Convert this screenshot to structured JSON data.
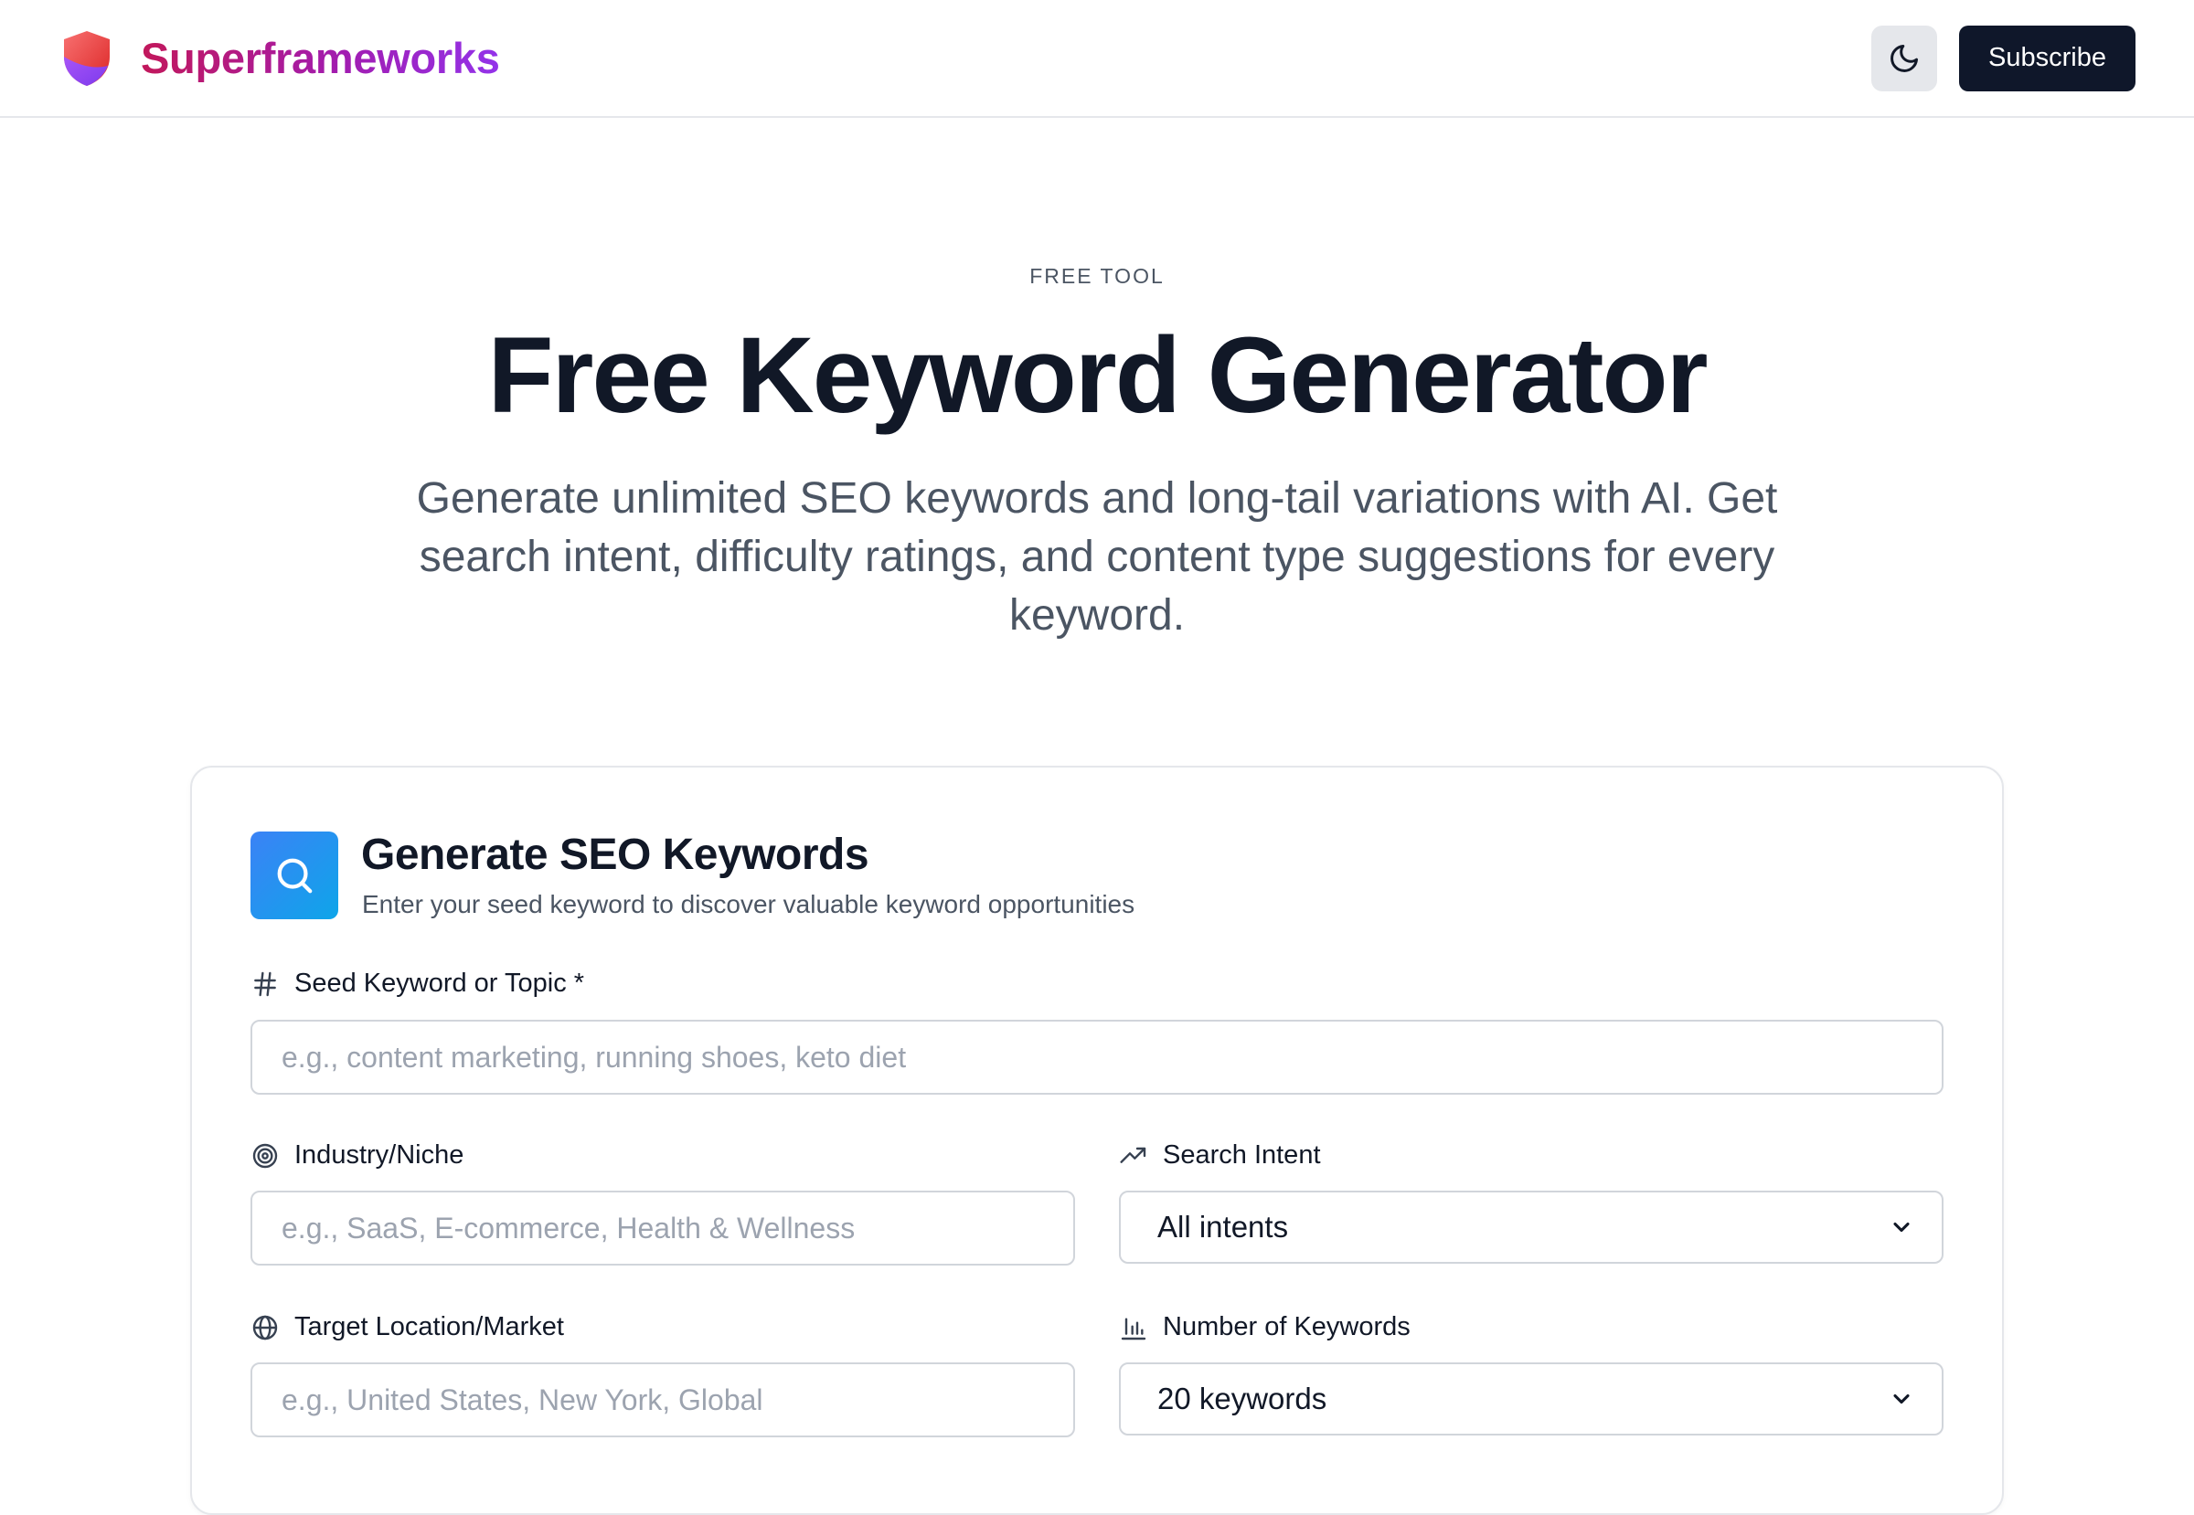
{
  "header": {
    "brand": "Superframeworks",
    "subscribe_label": "Subscribe",
    "icons": {
      "logo": "shield-logo-icon",
      "theme": "moon-icon"
    }
  },
  "hero": {
    "eyebrow": "FREE TOOL",
    "title": "Free Keyword Generator",
    "subtitle": "Generate unlimited SEO keywords and long-tail variations with AI. Get search intent, difficulty ratings, and content type suggestions for every keyword."
  },
  "card": {
    "title": "Generate SEO Keywords",
    "subtitle": "Enter your seed keyword to discover valuable keyword opportunities",
    "icon": "search-icon",
    "fields": {
      "seed": {
        "label": "Seed Keyword or Topic *",
        "placeholder": "e.g., content marketing, running shoes, keto diet",
        "value": ""
      },
      "industry": {
        "label": "Industry/Niche",
        "placeholder": "e.g., SaaS, E-commerce, Health & Wellness",
        "value": ""
      },
      "intent": {
        "label": "Search Intent",
        "selected": "All intents"
      },
      "location": {
        "label": "Target Location/Market",
        "placeholder": "e.g., United States, New York, Global",
        "value": ""
      },
      "count": {
        "label": "Number of Keywords",
        "selected": "20 keywords"
      }
    }
  },
  "colors": {
    "brand_gradient_start": "#c2185b",
    "brand_gradient_end": "#9333ea",
    "primary_button": "#0f172a",
    "card_icon_gradient_start": "#3b82f6",
    "card_icon_gradient_end": "#0ea5e9"
  }
}
